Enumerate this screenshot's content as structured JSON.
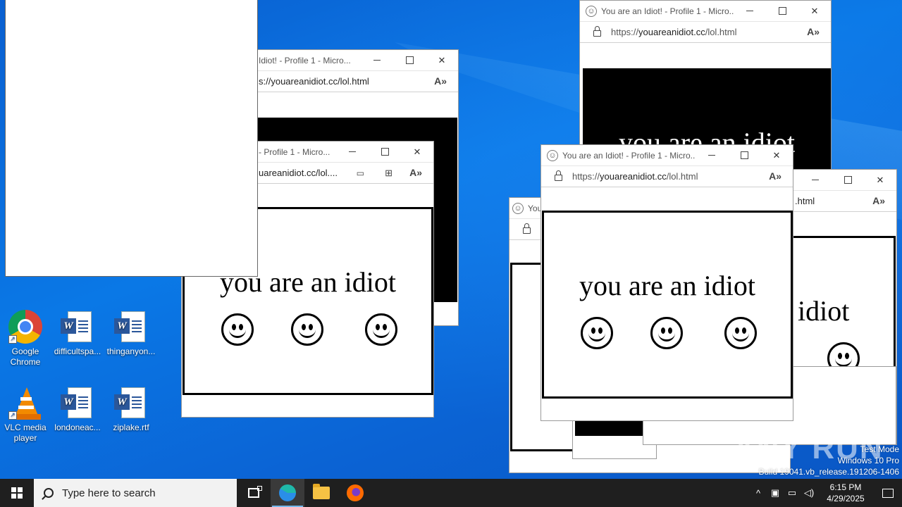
{
  "desktop": {
    "icons": [
      {
        "label": "Google Chrome",
        "type": "chrome"
      },
      {
        "label": "difficultspa...",
        "type": "word"
      },
      {
        "label": "thinganyon...",
        "type": "word"
      },
      {
        "label": "VLC media player",
        "type": "vlc"
      },
      {
        "label": "londoneac...",
        "type": "word"
      },
      {
        "label": "ziplake.rtf",
        "type": "word"
      }
    ]
  },
  "windows": {
    "title_full": "You are an Idiot! - Profile 1 - Micro...",
    "title_partial_a": "Idiot! - Profile 1 - Micro...",
    "title_partial_b": "- Profile 1 - Micro...",
    "title_partial_c": "You",
    "url_prefix": "https://",
    "url_host": "youareanidiot.cc",
    "url_path": "/lol.html",
    "url_partial_a": "s://youareanidiot.cc/lol.html",
    "url_partial_b": "uareanidiot.cc/lol....",
    "url_partial_c": ".html",
    "idiot_text": "you are an idiot",
    "idiot_text_partial": "n idiot",
    "read_aloud_icon": "A»"
  },
  "taskbar": {
    "search_placeholder": "Type here to search",
    "apps": [
      "task-view",
      "microsoft-edge",
      "file-explorer",
      "firefox"
    ],
    "time": "6:15 PM",
    "date": "4/29/2025"
  },
  "watermark": {
    "line1": "Test Mode",
    "line2": "Windows 10 Pro",
    "line3": "Build 19041.vb_release.191206-1406",
    "anyrun": "ANY RUN"
  }
}
